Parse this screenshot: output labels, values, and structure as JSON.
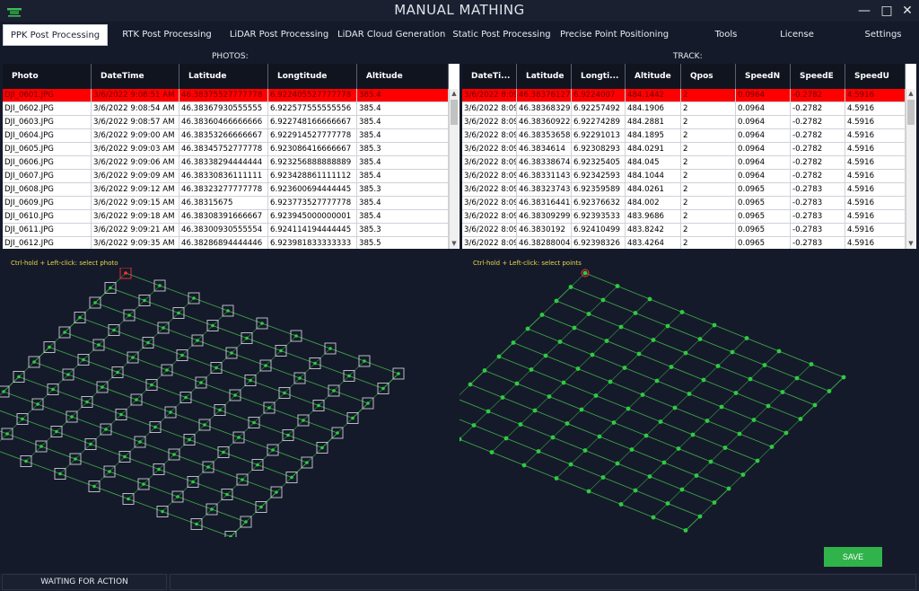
{
  "window": {
    "title": "MANUAL MATHING",
    "minimize_icon": "minimize-icon",
    "maximize_icon": "maximize-icon",
    "close_icon": "close-icon",
    "logo_icon": "drone-logo-icon"
  },
  "tabs": [
    {
      "label": "PPK Post Processing",
      "active": true
    },
    {
      "label": "RTK Post Processing",
      "active": false
    },
    {
      "label": "LiDAR Post Processing",
      "active": false
    },
    {
      "label": "LiDAR Cloud Generation",
      "active": false
    },
    {
      "label": "Static Post Processing",
      "active": false
    },
    {
      "label": "Precise Point Positioning",
      "active": false
    },
    {
      "label": "Tools",
      "active": false
    },
    {
      "label": "License",
      "active": false
    },
    {
      "label": "Settings",
      "active": false
    }
  ],
  "photos": {
    "label": "PHOTOS:",
    "columns": [
      "Photo",
      "DateTime",
      "Latitude",
      "Longtitude",
      "Altitude"
    ],
    "rows": [
      [
        "DJI_0601.JPG",
        "3/6/2022 9:08:51 AM",
        "46.38375527777778",
        "6.922405527777778",
        "385.4"
      ],
      [
        "DJI_0602.JPG",
        "3/6/2022 9:08:54 AM",
        "46.38367930555555",
        "6.922577555555556",
        "385.4"
      ],
      [
        "DJI_0603.JPG",
        "3/6/2022 9:08:57 AM",
        "46.38360466666666",
        "6.922748166666667",
        "385.4"
      ],
      [
        "DJI_0604.JPG",
        "3/6/2022 9:09:00 AM",
        "46.38353266666667",
        "6.922914527777778",
        "385.4"
      ],
      [
        "DJI_0605.JPG",
        "3/6/2022 9:09:03 AM",
        "46.38345752777778",
        "6.923086416666667",
        "385.3"
      ],
      [
        "DJI_0606.JPG",
        "3/6/2022 9:09:06 AM",
        "46.38338294444444",
        "6.923256888888889",
        "385.4"
      ],
      [
        "DJI_0607.JPG",
        "3/6/2022 9:09:09 AM",
        "46.38330836111111",
        "6.923428861111112",
        "385.4"
      ],
      [
        "DJI_0608.JPG",
        "3/6/2022 9:09:12 AM",
        "46.38323277777778",
        "6.923600694444445",
        "385.3"
      ],
      [
        "DJI_0609.JPG",
        "3/6/2022 9:09:15 AM",
        "46.38315675",
        "6.923773527777778",
        "385.4"
      ],
      [
        "DJI_0610.JPG",
        "3/6/2022 9:09:18 AM",
        "46.38308391666667",
        "6.923945000000001",
        "385.4"
      ],
      [
        "DJI_0611.JPG",
        "3/6/2022 9:09:21 AM",
        "46.38300930555554",
        "6.924114194444445",
        "385.3"
      ],
      [
        "DJI_0612.JPG",
        "3/6/2022 9:09:35 AM",
        "46.38286894444446",
        "6.923981833333333",
        "385.5"
      ]
    ],
    "selected_row": 0
  },
  "track": {
    "label": "TRACK:",
    "columns": [
      "DateTi...",
      "Latitude",
      "Longti...",
      "Altitude",
      "Qpos",
      "SpeedN",
      "SpeedE",
      "SpeedU"
    ],
    "rows": [
      [
        "3/6/2022 8:09",
        "46.38376127",
        "6.9224007",
        "484.1442",
        "2",
        "0.0964",
        "-0.2782",
        "4.5916"
      ],
      [
        "3/6/2022 8:09",
        "46.38368329",
        "6.92257492",
        "484.1906",
        "2",
        "0.0964",
        "-0.2782",
        "4.5916"
      ],
      [
        "3/6/2022 8:09",
        "46.38360922",
        "6.92274289",
        "484.2881",
        "2",
        "0.0964",
        "-0.2782",
        "4.5916"
      ],
      [
        "3/6/2022 8:09",
        "46.38353658",
        "6.92291013",
        "484.1895",
        "2",
        "0.0964",
        "-0.2782",
        "4.5916"
      ],
      [
        "3/6/2022 8:09",
        "46.3834614",
        "6.92308293",
        "484.0291",
        "2",
        "0.0964",
        "-0.2782",
        "4.5916"
      ],
      [
        "3/6/2022 8:09",
        "46.38338674",
        "6.92325405",
        "484.045",
        "2",
        "0.0964",
        "-0.2782",
        "4.5916"
      ],
      [
        "3/6/2022 8:09",
        "46.38331143",
        "6.92342593",
        "484.1044",
        "2",
        "0.0964",
        "-0.2782",
        "4.5916"
      ],
      [
        "3/6/2022 8:09",
        "46.38323743",
        "6.92359589",
        "484.0261",
        "2",
        "0.0965",
        "-0.2783",
        "4.5916"
      ],
      [
        "3/6/2022 8:09",
        "46.38316441",
        "6.92376632",
        "484.002",
        "2",
        "0.0965",
        "-0.2783",
        "4.5916"
      ],
      [
        "3/6/2022 8:09",
        "46.38309299",
        "6.92393533",
        "483.9686",
        "2",
        "0.0965",
        "-0.2783",
        "4.5916"
      ],
      [
        "3/6/2022 8:09",
        "46.3830192",
        "6.92410499",
        "483.8242",
        "2",
        "0.0965",
        "-0.2783",
        "4.5916"
      ],
      [
        "3/6/2022 8:09",
        "46.38288004",
        "6.92398326",
        "483.4264",
        "2",
        "0.0965",
        "-0.2783",
        "4.5916"
      ]
    ],
    "selected_row": 0
  },
  "photo_plot": {
    "hint": "Ctrl-hold + Left-click: select photo",
    "marker_color": "#2ecc40",
    "line_color": "#3ea84a",
    "selected_color": "#ff3030"
  },
  "track_plot": {
    "hint": "Ctrl-hold + Left-click: select points",
    "marker_color": "#2ecc40",
    "line_color": "#3ea84a",
    "selected_color": "#ff3030"
  },
  "save_label": "SAVE",
  "status": {
    "text": "WAITING FOR ACTION"
  }
}
